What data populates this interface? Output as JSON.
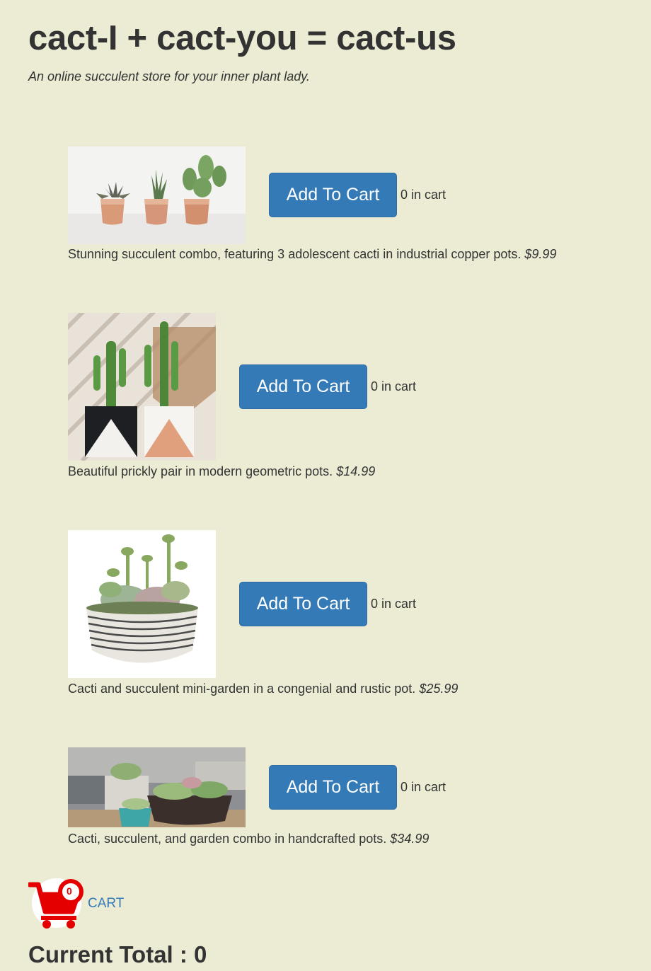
{
  "header": {
    "title": "cact-I + cact-you = cact-us",
    "subtitle": "An online succulent store for your inner plant lady."
  },
  "products": [
    {
      "description": "Stunning succulent combo, featuring 3 adolescent cacti in industrial copper pots.",
      "price": "$9.99",
      "button_label": "Add To Cart",
      "in_cart": "0 in cart"
    },
    {
      "description": "Beautiful prickly pair in modern geometric pots.",
      "price": "$14.99",
      "button_label": "Add To Cart",
      "in_cart": "0 in cart"
    },
    {
      "description": "Cacti and succulent mini-garden in a congenial and rustic pot.",
      "price": "$25.99",
      "button_label": "Add To Cart",
      "in_cart": "0 in cart"
    },
    {
      "description": "Cacti, succulent, and garden combo in handcrafted pots.",
      "price": "$34.99",
      "button_label": "Add To Cart",
      "in_cart": "0 in cart"
    }
  ],
  "cart": {
    "icon": "shopping-cart-icon",
    "badge_count": "0",
    "link_label": "CART",
    "total_label": "Current Total : 0"
  },
  "colors": {
    "background": "#ecebd4",
    "button": "#337ab7",
    "cart_icon": "#e50000",
    "link": "#337ab7"
  }
}
